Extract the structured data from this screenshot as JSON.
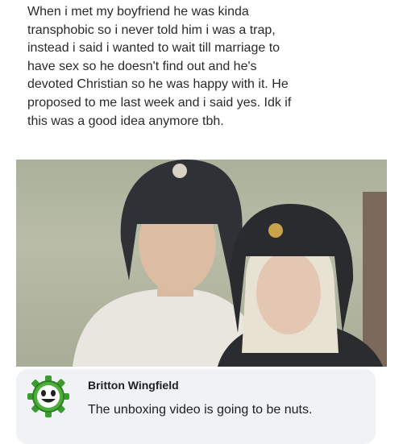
{
  "post": {
    "text": "When i met my boyfriend he was kinda\ntransphobic so i never told him i was a trap,\ninstead i said i wanted to wait till marriage to\nhave sex so he doesn't find out and he's\ndevoted Christian so he was happy with it. He\nproposed to me last week  and i said yes. Idk if\nthis was a good idea anymore tbh."
  },
  "comment": {
    "author": "Britton Wingfield",
    "text": "The unboxing video is going to be nuts.",
    "avatar_icon": "smiling-gear-icon",
    "avatar_color": "#3a9b2e"
  }
}
